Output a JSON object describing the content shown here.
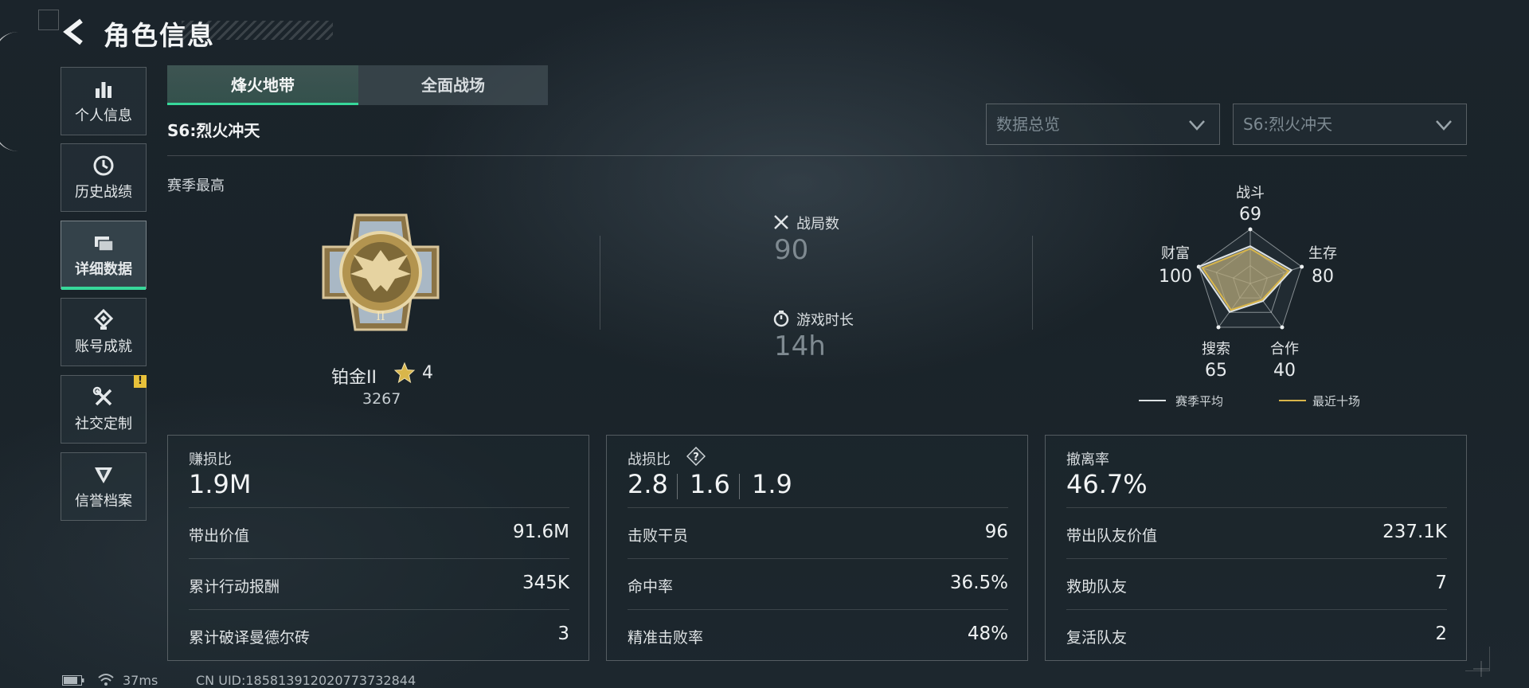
{
  "header": {
    "title": "角色信息"
  },
  "sidebar": {
    "items": [
      {
        "label": "个人信息",
        "icon": "bar-chart-icon"
      },
      {
        "label": "历史战绩",
        "icon": "history-icon"
      },
      {
        "label": "详细数据",
        "icon": "cards-icon",
        "active": true
      },
      {
        "label": "账号成就",
        "icon": "achievement-icon"
      },
      {
        "label": "社交定制",
        "icon": "tools-icon",
        "badge": "!"
      },
      {
        "label": "信誉档案",
        "icon": "shield-emblem-icon"
      }
    ]
  },
  "tabs": [
    {
      "label": "烽火地带",
      "active": true
    },
    {
      "label": "全面战场"
    }
  ],
  "season_label": "S6:烈火冲天",
  "filters": {
    "view": "数据总览",
    "season": "S6:烈火冲天"
  },
  "overview": {
    "section_label": "赛季最高",
    "rank": {
      "name": "铂金II",
      "stars": "4",
      "score": "3267"
    },
    "matches": {
      "label": "战局数",
      "value": "90"
    },
    "playtime": {
      "label": "游戏时长",
      "value": "14h"
    }
  },
  "radar": {
    "axes": [
      {
        "label": "战斗",
        "value": "69"
      },
      {
        "label": "生存",
        "value": "80"
      },
      {
        "label": "合作",
        "value": "40"
      },
      {
        "label": "搜索",
        "value": "65"
      },
      {
        "label": "财富",
        "value": "100"
      }
    ],
    "legend": [
      {
        "label": "赛季平均",
        "color": "#dde2e4"
      },
      {
        "label": "最近十场",
        "color": "#d9b64a"
      }
    ]
  },
  "cards": [
    {
      "title": "赚损比",
      "value": "1.9M",
      "rows": [
        {
          "label": "带出价值",
          "value": "91.6M"
        },
        {
          "label": "累计行动报酬",
          "value": "345K"
        },
        {
          "label": "累计破译曼德尔砖",
          "value": "3"
        }
      ]
    },
    {
      "title": "战损比",
      "values": [
        "2.8",
        "1.6",
        "1.9"
      ],
      "rows": [
        {
          "label": "击败干员",
          "value": "96"
        },
        {
          "label": "命中率",
          "value": "36.5%"
        },
        {
          "label": "精准击败率",
          "value": "48%"
        }
      ]
    },
    {
      "title": "撤离率",
      "value": "46.7%",
      "rows": [
        {
          "label": "带出队友价值",
          "value": "237.1K"
        },
        {
          "label": "救助队友",
          "value": "7"
        },
        {
          "label": "复活队友",
          "value": "2"
        }
      ]
    }
  ],
  "footer": {
    "ping": "37ms",
    "uid": "CN UID:185813912020773732844"
  },
  "colors": {
    "accent": "#37d89a",
    "gold": "#d9b64a",
    "badge": "#e8c13a"
  }
}
